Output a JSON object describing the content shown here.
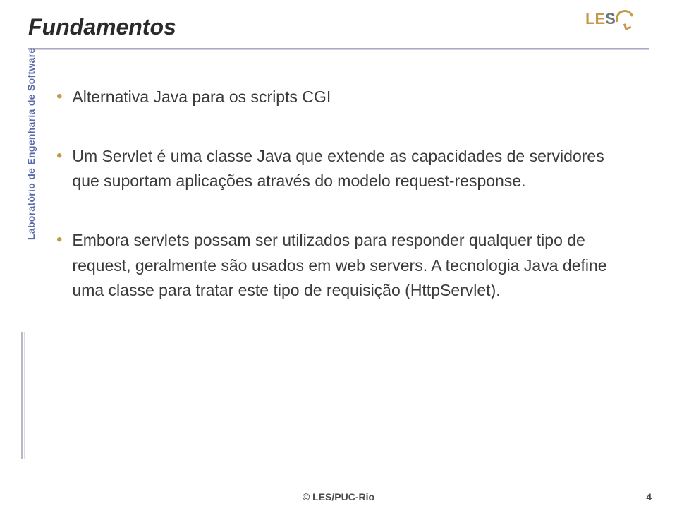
{
  "title": "Fundamentos",
  "sidebar_label": "Laboratório de Engenharia de Software",
  "logo": {
    "part1": "LE",
    "part2": "S"
  },
  "bullets": [
    "Alternativa Java para os scripts CGI",
    "Um Servlet é uma classe Java que extende as capacidades  de servidores que suportam aplicações através do modelo request-response.",
    "Embora servlets possam ser utilizados para responder qualquer tipo de request, geralmente são usados em web servers. A tecnologia Java define uma classe para tratar este tipo de requisição (HttpServlet)."
  ],
  "footer": "© LES/PUC-Rio",
  "page_number": "4"
}
